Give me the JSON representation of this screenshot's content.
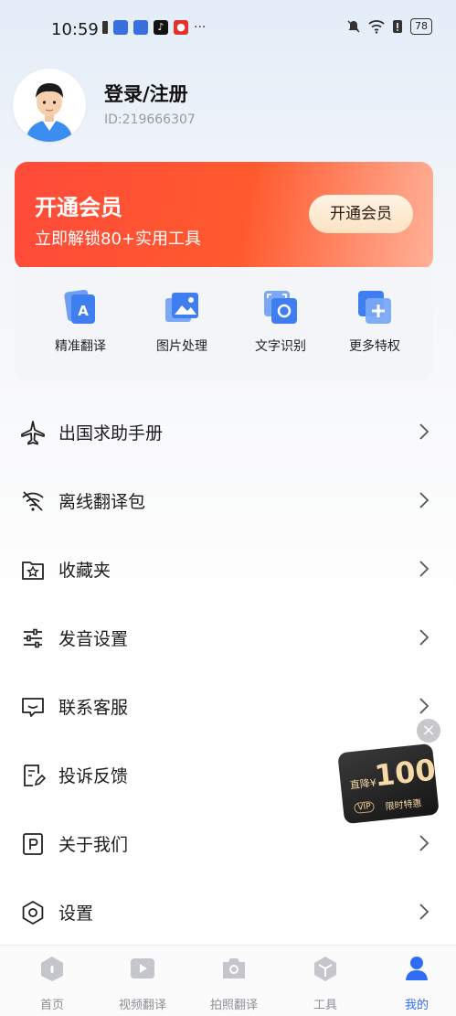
{
  "status_bar": {
    "time": "10:59",
    "battery": "78"
  },
  "profile": {
    "title": "登录/注册",
    "user_id": "ID:219666307"
  },
  "vip": {
    "title": "开通会员",
    "subtitle": "立即解锁80+实用工具",
    "button": "开通会员"
  },
  "perks": [
    {
      "label": "精准翻译",
      "icon": "translate-doc-icon"
    },
    {
      "label": "图片处理",
      "icon": "image-icon"
    },
    {
      "label": "文字识别",
      "icon": "text-recognition-icon"
    },
    {
      "label": "更多特权",
      "icon": "plus-icon"
    }
  ],
  "menu": [
    {
      "label": "出国求助手册",
      "icon": "airplane-icon"
    },
    {
      "label": "离线翻译包",
      "icon": "wifi-off-icon"
    },
    {
      "label": "收藏夹",
      "icon": "star-folder-icon"
    },
    {
      "label": "发音设置",
      "icon": "sliders-icon"
    },
    {
      "label": "联系客服",
      "icon": "chat-icon"
    },
    {
      "label": "投诉反馈",
      "icon": "feedback-icon"
    },
    {
      "label": "关于我们",
      "icon": "p-badge-icon"
    },
    {
      "label": "设置",
      "icon": "gear-icon"
    }
  ],
  "promo": {
    "prefix": "直降¥",
    "amount": "100",
    "vip": "VIP",
    "tag": "限时特惠",
    "close": "×"
  },
  "tabs": [
    {
      "label": "首页",
      "icon": "home-icon"
    },
    {
      "label": "视频翻译",
      "icon": "video-icon"
    },
    {
      "label": "拍照翻译",
      "icon": "camera-icon"
    },
    {
      "label": "工具",
      "icon": "tools-icon"
    },
    {
      "label": "我的",
      "icon": "person-icon"
    }
  ],
  "colors": {
    "accent": "#2f6df6",
    "vip_red": "#ff4b3a"
  }
}
